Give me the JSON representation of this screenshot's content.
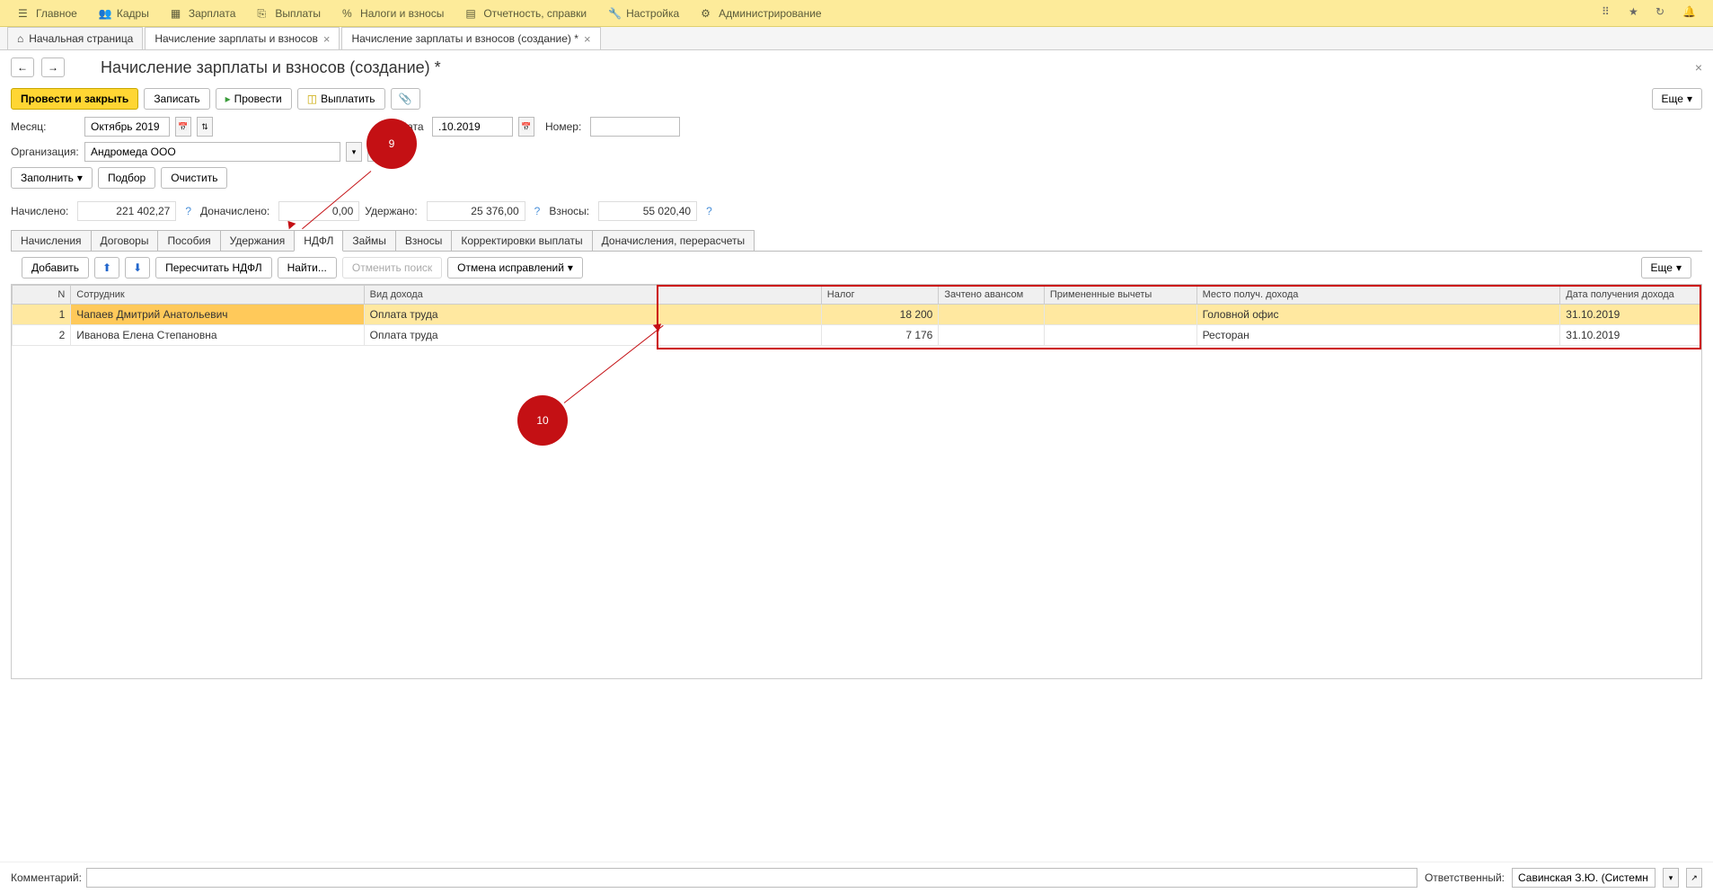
{
  "topMenu": {
    "items": [
      {
        "label": "Главное",
        "icon": "menu"
      },
      {
        "label": "Кадры",
        "icon": "users"
      },
      {
        "label": "Зарплата",
        "icon": "calc"
      },
      {
        "label": "Выплаты",
        "icon": "money"
      },
      {
        "label": "Налоги и взносы",
        "icon": "percent"
      },
      {
        "label": "Отчетность, справки",
        "icon": "docs"
      },
      {
        "label": "Настройка",
        "icon": "wrench"
      },
      {
        "label": "Администрирование",
        "icon": "gear"
      }
    ]
  },
  "appTabs": [
    {
      "label": "Начальная страница",
      "home": true
    },
    {
      "label": "Начисление зарплаты и взносов",
      "close": true
    },
    {
      "label": "Начисление зарплаты и взносов (создание) *",
      "close": true,
      "active": true
    }
  ],
  "page": {
    "title": "Начисление зарплаты и взносов (создание) *"
  },
  "actions": {
    "postClose": "Провести и закрыть",
    "save": "Записать",
    "post": "Провести",
    "pay": "Выплатить",
    "more": "Еще"
  },
  "form": {
    "monthLabel": "Месяц:",
    "monthValue": "Октябрь 2019",
    "dateLabel": "Дата:",
    "dateValue": ".10.2019",
    "numberLabel": "Номер:",
    "numberValue": "",
    "orgLabel": "Организация:",
    "orgValue": "Андромеда ООО",
    "fill": "Заполнить",
    "select": "Подбор",
    "clear": "Очистить"
  },
  "totals": {
    "accruedLabel": "Начислено:",
    "accruedValue": "221 402,27",
    "extraLabel": "Доначислено:",
    "extraValue": "0,00",
    "withheldLabel": "Удержано:",
    "withheldValue": "25 376,00",
    "contribLabel": "Взносы:",
    "contribValue": "55 020,40"
  },
  "subtabs": [
    "Начисления",
    "Договоры",
    "Пособия",
    "Удержания",
    "НДФЛ",
    "Займы",
    "Взносы",
    "Корректировки выплаты",
    "Доначисления, перерасчеты"
  ],
  "subtabActive": 4,
  "tableToolbar": {
    "add": "Добавить",
    "recalc": "Пересчитать НДФЛ",
    "find": "Найти...",
    "cancelFind": "Отменить поиск",
    "cancelFix": "Отмена исправлений",
    "more": "Еще"
  },
  "table": {
    "headers": {
      "n": "N",
      "employee": "Сотрудник",
      "incomeType": "Вид дохода",
      "tax": "Налог",
      "advance": "Зачтено авансом",
      "deductions": "Примененные вычеты",
      "place": "Место получ. дохода",
      "date": "Дата получения дохода"
    },
    "rows": [
      {
        "n": "1",
        "employee": "Чапаев Дмитрий Анатольевич",
        "incomeType": "Оплата труда",
        "tax": "18 200",
        "advance": "",
        "deductions": "",
        "place": "Головной офис",
        "date": "31.10.2019"
      },
      {
        "n": "2",
        "employee": "Иванова Елена Степановна",
        "incomeType": "Оплата труда",
        "tax": "7 176",
        "advance": "",
        "deductions": "",
        "place": "Ресторан",
        "date": "31.10.2019"
      }
    ]
  },
  "footer": {
    "commentLabel": "Комментарий:",
    "commentValue": "",
    "respLabel": "Ответственный:",
    "respValue": "Савинская З.Ю. (Системн"
  },
  "annotations": {
    "nine": "9",
    "ten": "10"
  }
}
